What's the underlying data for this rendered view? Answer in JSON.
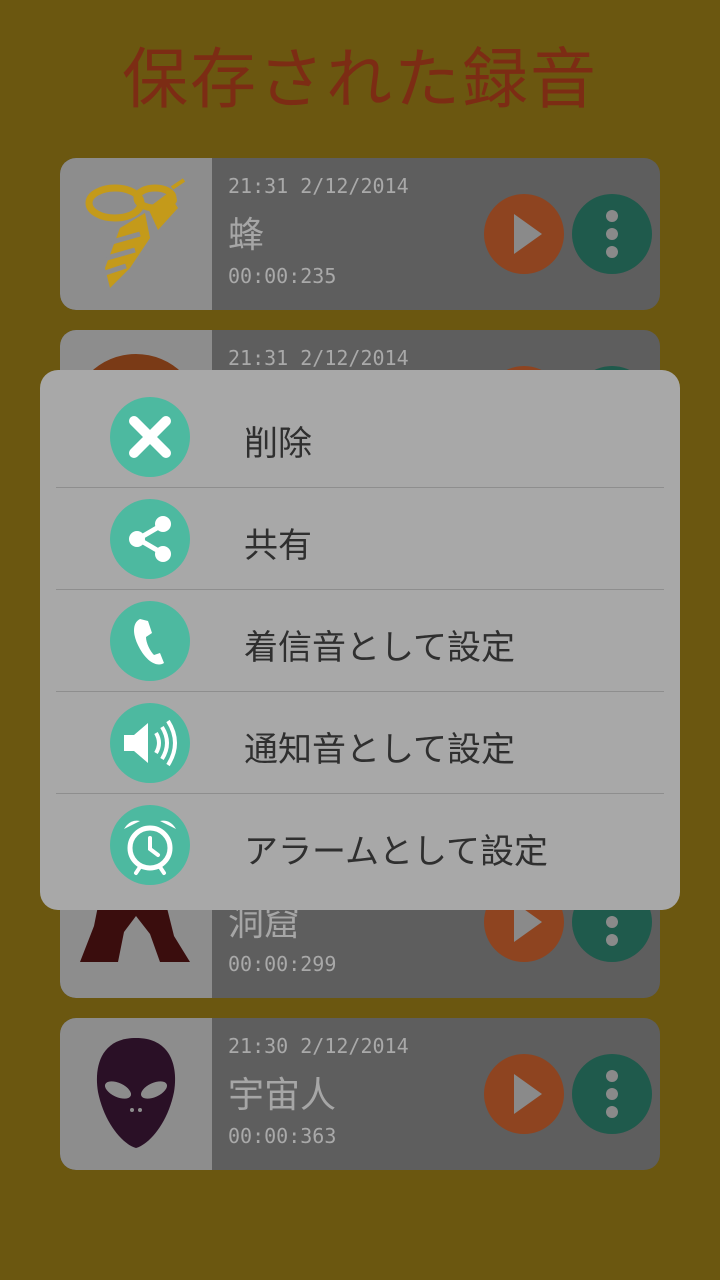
{
  "page": {
    "title": "保存された録音"
  },
  "recordings": [
    {
      "date": "21:31 2/12/2014",
      "name": "蜂",
      "duration": "00:00:235",
      "icon": "bee-icon"
    },
    {
      "date": "21:31 2/12/2014",
      "name": "",
      "duration": "",
      "icon": "circle-thumb-icon"
    },
    {
      "date": "",
      "name": "洞窟",
      "duration": "00:00:299",
      "icon": "cave-icon"
    },
    {
      "date": "21:30 2/12/2014",
      "name": "宇宙人",
      "duration": "00:00:363",
      "icon": "alien-icon"
    }
  ],
  "menu": {
    "items": [
      {
        "label": "削除",
        "icon": "close-icon"
      },
      {
        "label": "共有",
        "icon": "share-icon"
      },
      {
        "label": "着信音として設定",
        "icon": "phone-icon"
      },
      {
        "label": "通知音として設定",
        "icon": "speaker-icon"
      },
      {
        "label": "アラームとして設定",
        "icon": "alarm-clock-icon"
      }
    ]
  },
  "colors": {
    "background": "#6b5710",
    "title": "#7c2c14",
    "card": "#5e5e5e",
    "play_button": "#8e4420",
    "more_button": "#1f5a4c",
    "dialog": "#a8a8a8",
    "menu_icon": "#4db9a0"
  }
}
